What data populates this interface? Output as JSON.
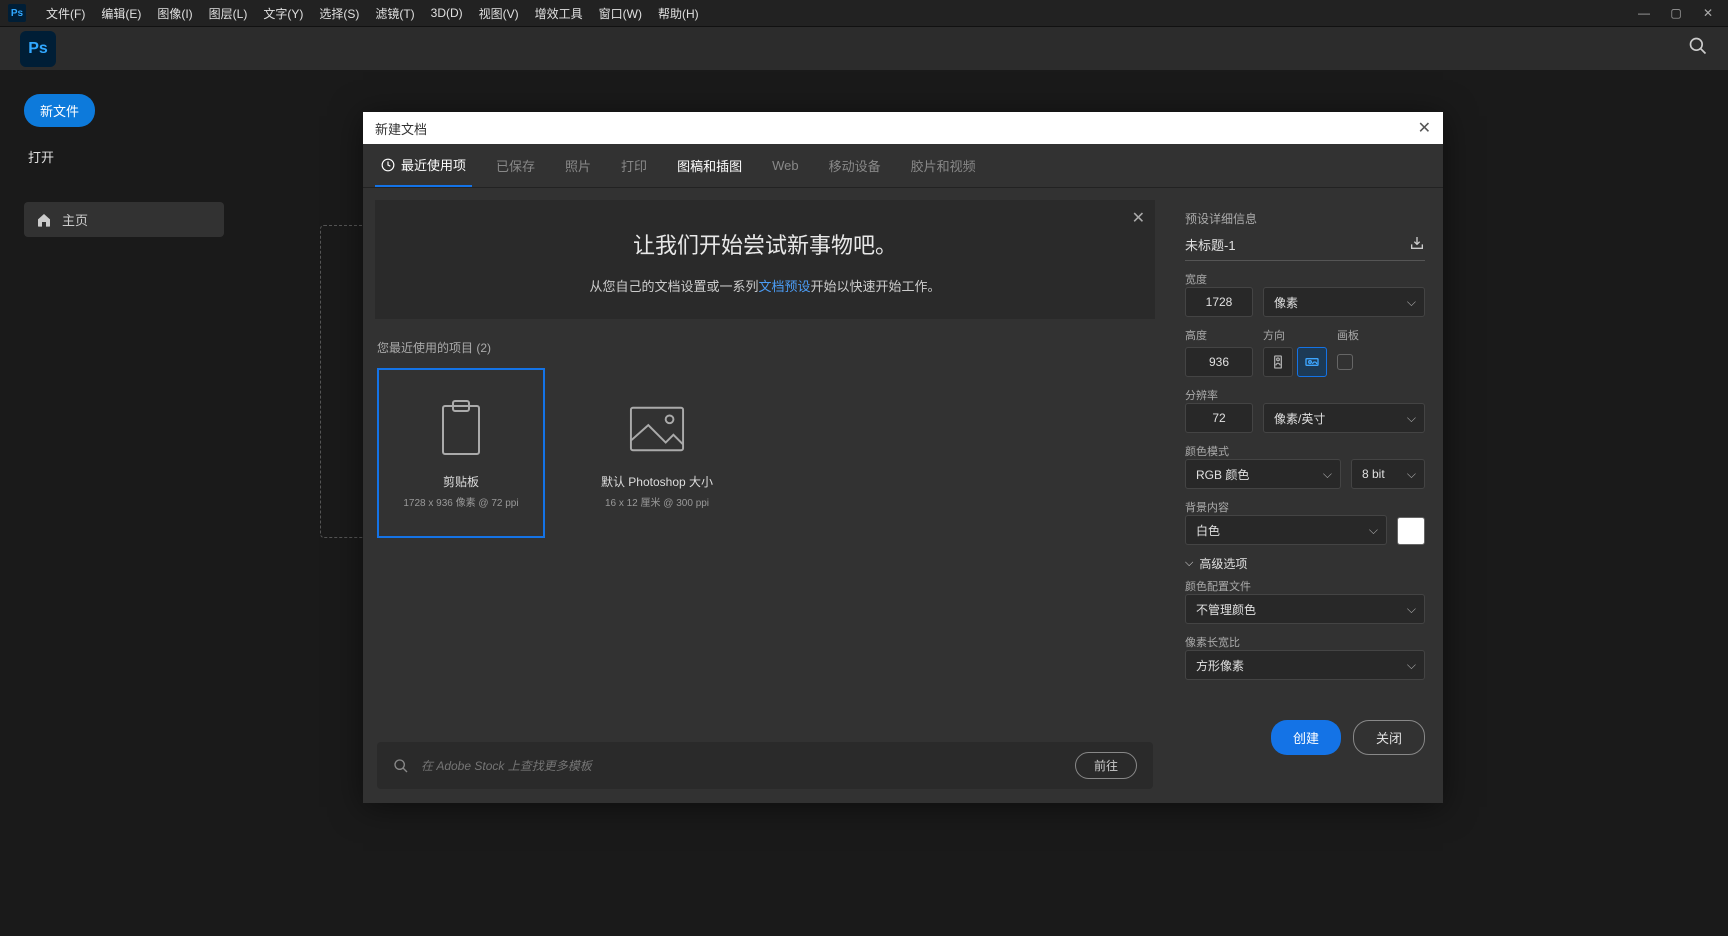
{
  "menubar": {
    "items": [
      "文件(F)",
      "编辑(E)",
      "图像(I)",
      "图层(L)",
      "文字(Y)",
      "选择(S)",
      "滤镜(T)",
      "3D(D)",
      "视图(V)",
      "增效工具",
      "窗口(W)",
      "帮助(H)"
    ]
  },
  "sidebar": {
    "new_file": "新文件",
    "open": "打开",
    "home": "主页"
  },
  "dialog": {
    "title": "新建文档",
    "tabs": [
      "最近使用项",
      "已保存",
      "照片",
      "打印",
      "图稿和插图",
      "Web",
      "移动设备",
      "胶片和视频"
    ],
    "hero": {
      "title": "让我们开始尝试新事物吧。",
      "text_before": "从您自己的文档设置或一系列",
      "link": "文档预设",
      "text_after": "开始以快速开始工作。"
    },
    "recent_label": "您最近使用的项目 (2)",
    "presets": [
      {
        "title": "剪贴板",
        "subtitle": "1728 x 936 像素 @ 72 ppi"
      },
      {
        "title": "默认 Photoshop 大小",
        "subtitle": "16 x 12 厘米 @ 300 ppi"
      }
    ],
    "search_placeholder": "在 Adobe Stock 上查找更多模板",
    "go_label": "前往",
    "details": {
      "header": "预设详细信息",
      "name": "未标题-1",
      "width_label": "宽度",
      "width": "1728",
      "unit": "像素",
      "height_label": "高度",
      "height": "936",
      "orientation_label": "方向",
      "artboard_label": "画板",
      "resolution_label": "分辨率",
      "resolution": "72",
      "resolution_unit": "像素/英寸",
      "color_mode_label": "颜色模式",
      "color_mode": "RGB 颜色",
      "bit_depth": "8 bit",
      "bg_label": "背景内容",
      "bg": "白色",
      "advanced_label": "高级选项",
      "profile_label": "颜色配置文件",
      "profile": "不管理颜色",
      "aspect_label": "像素长宽比",
      "aspect": "方形像素"
    },
    "create": "创建",
    "close": "关闭"
  }
}
